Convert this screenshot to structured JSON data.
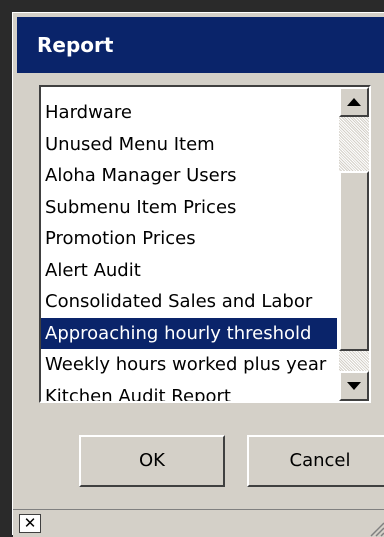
{
  "window": {
    "title": "Report"
  },
  "report_list": {
    "items": [
      "Hardware",
      "Unused Menu Item",
      "Aloha Manager Users",
      "Submenu Item Prices",
      "Promotion Prices",
      "Alert Audit",
      "Consolidated Sales and Labor",
      "Approaching hourly threshold",
      "Weekly hours worked plus year",
      "Kitchen Audit Report"
    ],
    "selected": "Approaching hourly threshold"
  },
  "buttons": {
    "ok_label": "OK",
    "cancel_label": "Cancel"
  },
  "statusbar": {
    "close_glyph": "✕"
  },
  "colors": {
    "selection": "#0a246a",
    "titlebar": "#0a246a",
    "face": "#d4d0c8"
  }
}
